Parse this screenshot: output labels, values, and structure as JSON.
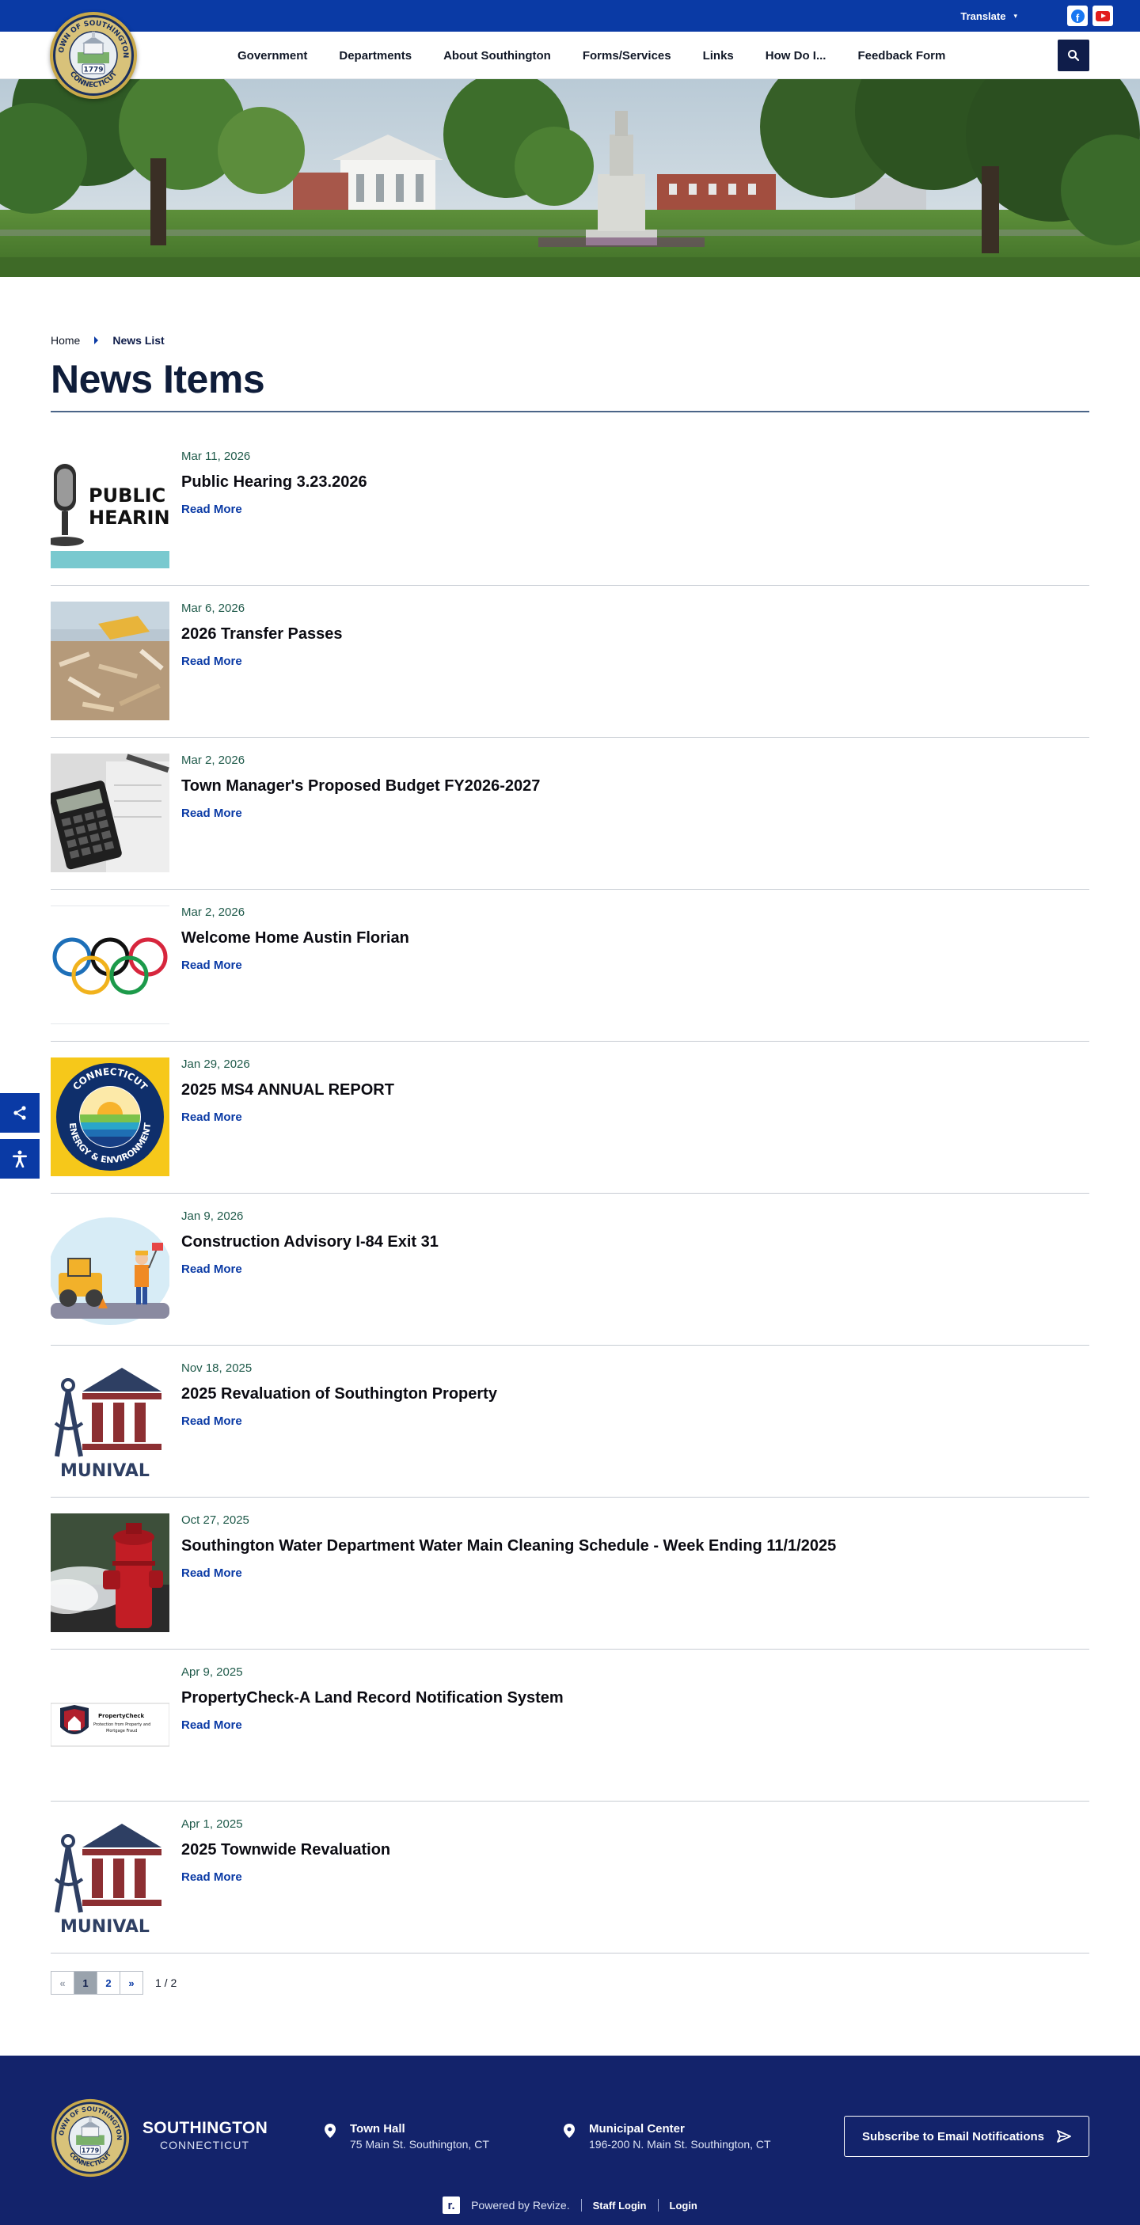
{
  "topbar": {
    "translate_label": "Translate",
    "social": [
      "facebook-icon",
      "youtube-icon"
    ]
  },
  "seal": {
    "top_text": "TOWN OF SOUTHINGTON",
    "bottom_text": "CONNECTICUT",
    "year": "1779"
  },
  "nav": {
    "items": [
      "Government",
      "Departments",
      "About Southington",
      "Forms/Services",
      "Links",
      "How Do I...",
      "Feedback Form"
    ]
  },
  "breadcrumb": {
    "home": "Home",
    "current": "News List"
  },
  "page": {
    "title": "News Items"
  },
  "news": [
    {
      "date": "Mar 11, 2026",
      "title": "Public Hearing 3.23.2026",
      "more": "Read More",
      "thumb": "public-hearing",
      "thumb_text": [
        "PUBLIC",
        "HEARING"
      ]
    },
    {
      "date": "Mar 6, 2026",
      "title": "2026 Transfer Passes",
      "more": "Read More",
      "thumb": "transfer"
    },
    {
      "date": "Mar 2, 2026",
      "title": "Town Manager's Proposed Budget FY2026-2027",
      "more": "Read More",
      "thumb": "budget"
    },
    {
      "date": "Mar 2, 2026",
      "title": "Welcome Home Austin Florian",
      "more": "Read More",
      "thumb": "olympics"
    },
    {
      "date": "Jan 29, 2026",
      "title": "2025 MS4 ANNUAL REPORT",
      "more": "Read More",
      "thumb": "energy",
      "thumb_text": [
        "CONNECTICUT",
        "ENERGY & ENVIRONMENT"
      ]
    },
    {
      "date": "Jan 9, 2026",
      "title": "Construction Advisory I-84 Exit 31",
      "more": "Read More",
      "thumb": "construction"
    },
    {
      "date": "Nov 18, 2025",
      "title": "2025 Revaluation of Southington Property",
      "more": "Read More",
      "thumb": "munival",
      "thumb_text": [
        "MUNIVAL"
      ]
    },
    {
      "date": "Oct 27, 2025",
      "title": "Southington Water Department Water Main Cleaning Schedule - Week Ending 11/1/2025",
      "more": "Read More",
      "thumb": "hydrant"
    },
    {
      "date": "Apr 9, 2025",
      "title": "PropertyCheck-A Land Record Notification System",
      "more": "Read More",
      "thumb": "propertycheck",
      "thumb_text": [
        "PropertyCheck",
        "Protection from Property and",
        "Mortgage Fraud"
      ]
    },
    {
      "date": "Apr 1, 2025",
      "title": "2025 Townwide Revaluation",
      "more": "Read More",
      "thumb": "munival",
      "thumb_text": [
        "MUNIVAL"
      ]
    }
  ],
  "pagination": {
    "prev": "«",
    "pages": [
      "1",
      "2"
    ],
    "active": "1",
    "next": "»",
    "count": "1 / 2"
  },
  "side_tools": [
    "share-icon",
    "accessibility-icon"
  ],
  "footer": {
    "name": "SOUTHINGTON",
    "state": "CONNECTICUT",
    "locations": [
      {
        "name": "Town Hall",
        "address": "75 Main St. Southington, CT"
      },
      {
        "name": "Municipal Center",
        "address": "196-200 N. Main St. Southington, CT"
      }
    ],
    "subscribe": "Subscribe to Email Notifications",
    "revize_mark": "r.",
    "powered": "Powered by Revize.",
    "staff_login": "Staff Login",
    "login": "Login"
  },
  "colors": {
    "brand_blue": "#0a3aa5",
    "navy": "#0f1d4a",
    "footer_navy": "#13236b",
    "date_green": "#1f5a4a"
  }
}
